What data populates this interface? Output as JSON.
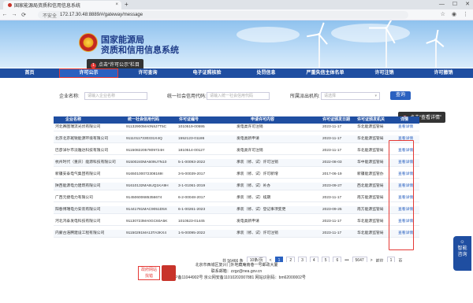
{
  "browser": {
    "tab_title": "国家能源局资质和信用信息系统",
    "tab_close": "×",
    "new_tab": "+",
    "win_min": "—",
    "win_max": "☐",
    "win_close": "✕",
    "insecure_label": "不安全",
    "url": "172.17.30.48:8889/#/gateway/message",
    "back": "←",
    "forward": "→",
    "reload": "⟳"
  },
  "banner": {
    "title_line1": "国家能源局",
    "title_line2": "资质和信用信息系统"
  },
  "hints": {
    "nav_hint_num": "1",
    "nav_hint_text": "点击“许可公示”栏目",
    "detail_hint_num": "2",
    "detail_hint_text": "点击“查看详情”"
  },
  "nav": {
    "items": [
      "首页",
      "许可公示",
      "许可查询",
      "电子证照核验",
      "处罚信息",
      "严重失信主体名单",
      "许可注销",
      "许可撤销"
    ],
    "active_index": 1
  },
  "search": {
    "company_label": "企业名称:",
    "company_placeholder": "请输入企业名称",
    "credit_label": "统一社会信用代码:",
    "credit_placeholder": "请输入统一社会信用代码",
    "agency_label": "所属派出机构:",
    "agency_placeholder": "请选择",
    "button": "查询"
  },
  "table": {
    "headers": [
      "企业名称",
      "统一社会信用代码",
      "许可证编号",
      "申请许可内容",
      "许可证颁发日期",
      "许可证颁发机关",
      "详情"
    ],
    "rows": [
      [
        "河北赛图瑞流光伏有限公司",
        "91132900MA0N8J7T5C",
        "1010519-00595",
        "发电类许可注销",
        "2023-11-17",
        "华北能源监管局",
        "查看详情"
      ],
      [
        "北京北京斑锐能源环境有限公司",
        "91110117330331X4Q",
        "1552123-01186",
        "发电类新申请",
        "2023-11-17",
        "华北能源监管局",
        "查看详情"
      ],
      [
        "巴彦淖尔市淡雅达科技有限公司",
        "91150822057809724H",
        "1810514-00127",
        "发电类许可注销",
        "2023-11-17",
        "华北能源监管局",
        "查看详情"
      ],
      [
        "杭州时代（重庆）能源科技有限公司",
        "91500240MA609U7N10",
        "5-1-00093-2022",
        "承装（修、试）许可注销",
        "2022-08-03",
        "华中能源监管局",
        "查看详情"
      ],
      [
        "新疆安泰电气集团有限公司",
        "91650100072308169I",
        "3-5-00039-2017",
        "承装（修、试）许可新增",
        "2017-06-19",
        "新疆能源监管办",
        "查看详情"
      ],
      [
        "陕西能源电力建筑有限公司",
        "91610132MA6UQ1KA9H",
        "3-1-01061-2019",
        "承装（修、试）补办",
        "2023-09-27",
        "西北能源监管局",
        "查看详情"
      ],
      [
        "广西元捷电力有限公司",
        "91450600685356674",
        "6-2-00048-2017",
        "承装（修、试）续期",
        "2023-11-17",
        "南方能源监管局",
        "查看详情"
      ],
      [
        "阳春博瑞电力安装有限公司",
        "91441781MAC9051D5X",
        "6-1-00261-2023",
        "承装（修、试）登记事项变更",
        "2023-09-25",
        "南方能源监管局",
        "查看详情"
      ],
      [
        "河北鸿泰发电科技有限公司",
        "91130723MA0GC60A5K",
        "1010523-01445",
        "发电类新申请",
        "2023-11-17",
        "华北能源监管局",
        "查看详情"
      ],
      [
        "内蒙古浩腾建设工程有限公司",
        "91150291MA13TA3KX4",
        "1-5-00095-2022",
        "承装（修、试）许可注销",
        "2023-11-17",
        "华北能源监管局",
        "查看详情"
      ]
    ]
  },
  "pager": {
    "total": "共 56466 条",
    "page_size": "10条/页",
    "prev": "<",
    "pages": [
      "1",
      "2",
      "3",
      "4",
      "5",
      "6"
    ],
    "ellipsis": "•••",
    "last": "5647",
    "next": ">",
    "goto_label": "前往",
    "goto_value": "1",
    "goto_unit": "页"
  },
  "footer": {
    "address": "北京市西城区复兴门外地藏庵南巷一号邮政大厦",
    "contact": "联系邮箱：zzgz@nea.gov.cn",
    "icp": "京ICP备11044902号 京公网安备11010202007881 网站识别码：bm62000002号",
    "gov_badge_line1": "政府网站",
    "gov_badge_line2": "找错"
  },
  "side_float": {
    "label_1": "智",
    "label_2": "能",
    "label_3": "咨",
    "label_4": "询"
  },
  "colors": {
    "nav_blue": "#1f4ea1",
    "accent_red": "#e53935"
  }
}
